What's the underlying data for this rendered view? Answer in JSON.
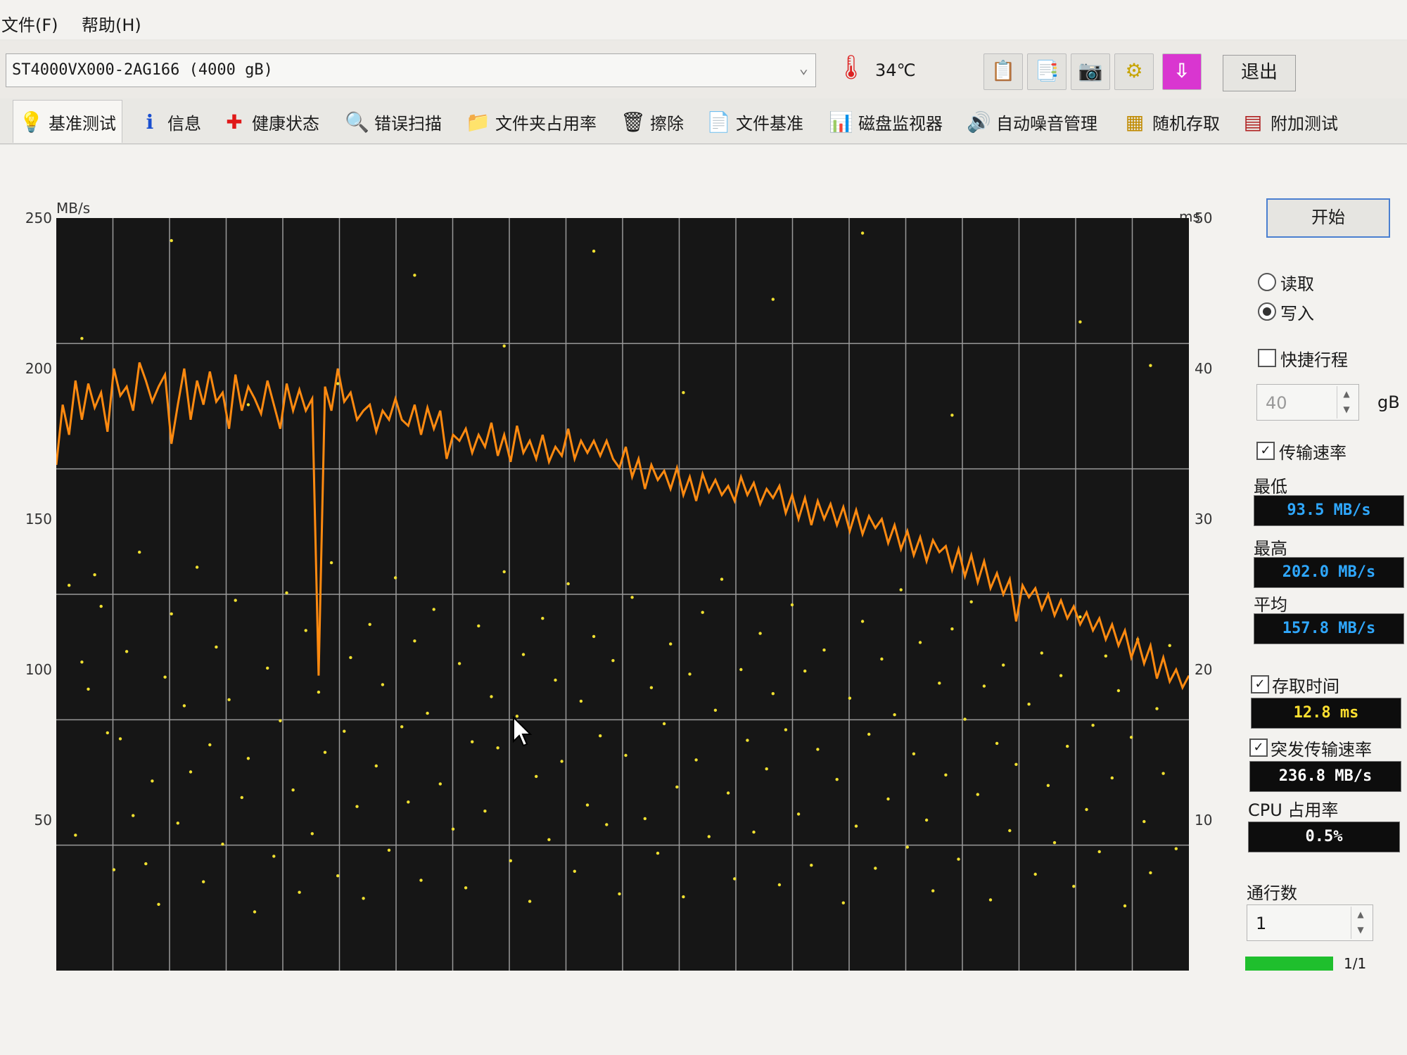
{
  "menu": {
    "file": "文件(F)",
    "help": "帮助(H)"
  },
  "toolbar": {
    "drive": "ST4000VX000-2AG166 (4000 gB)",
    "temperature": "34℃",
    "exit_label": "退出",
    "icons": [
      "copy-text-icon",
      "copy-graph-icon",
      "camera-icon",
      "settings-icon",
      "download-icon"
    ]
  },
  "tabs": [
    {
      "label": "基准测试",
      "icon": "benchmark-icon"
    },
    {
      "label": "信息",
      "icon": "info-icon"
    },
    {
      "label": "健康状态",
      "icon": "health-icon"
    },
    {
      "label": "错误扫描",
      "icon": "error-scan-icon"
    },
    {
      "label": "文件夹占用率",
      "icon": "folder-icon"
    },
    {
      "label": "擦除",
      "icon": "erase-icon"
    },
    {
      "label": "文件基准",
      "icon": "file-benchmark-icon"
    },
    {
      "label": "磁盘监视器",
      "icon": "disk-monitor-icon"
    },
    {
      "label": "自动噪音管理",
      "icon": "noise-icon"
    },
    {
      "label": "随机存取",
      "icon": "random-access-icon"
    },
    {
      "label": "附加测试",
      "icon": "extra-tests-icon"
    }
  ],
  "panel": {
    "start_label": "开始",
    "read_label": "读取",
    "write_label": "写入",
    "write_selected": true,
    "quick_label": "快捷行程",
    "quick_checked": false,
    "quick_value": "40",
    "quick_unit": "gB",
    "transfer_label": "传输速率",
    "transfer_checked": true,
    "min_label": "最低",
    "min_value": "93.5 MB/s",
    "max_label": "最高",
    "max_value": "202.0 MB/s",
    "avg_label": "平均",
    "avg_value": "157.8 MB/s",
    "access_label": "存取时间",
    "access_checked": true,
    "access_value": "12.8 ms",
    "burst_label": "突发传输速率",
    "burst_checked": true,
    "burst_value": "236.8 MB/s",
    "cpu_label": "CPU 占用率",
    "cpu_value": "0.5%",
    "passes_label": "通行数",
    "passes_value": "1",
    "progress_text": "1/1",
    "progress": 1.0,
    "readout_blue": "#2fa8ff",
    "readout_yellow": "#ffe030"
  },
  "chart_data": {
    "type": "line",
    "ylabel_left": "MB/s",
    "ylabel_right": "ms",
    "ylim": [
      0,
      250
    ],
    "ylim_right": [
      0,
      50
    ],
    "yticks_left": [
      50,
      100,
      150,
      200,
      250
    ],
    "yticks_right": [
      10,
      20,
      30,
      40,
      50
    ],
    "grid": true,
    "line_color": "#ff8a10",
    "dot_color": "#f0e030",
    "background": "#161616",
    "series": [
      {
        "values": [
          168,
          188,
          178,
          196,
          183,
          195,
          187,
          192,
          179,
          200,
          191,
          194,
          186,
          202,
          196,
          189,
          194,
          198,
          175,
          188,
          200,
          183,
          196,
          188,
          199,
          189,
          192,
          180,
          198,
          186,
          194,
          190,
          185,
          196,
          188,
          180,
          195,
          186,
          193,
          186,
          190,
          98,
          194,
          186,
          200,
          189,
          192,
          183,
          186,
          188,
          179,
          186,
          183,
          190,
          183,
          181,
          188,
          178,
          187,
          180,
          186,
          170,
          178,
          176,
          180,
          172,
          178,
          174,
          182,
          171,
          178,
          169,
          181,
          172,
          176,
          170,
          178,
          169,
          174,
          171,
          180,
          170,
          176,
          172,
          176,
          171,
          176,
          170,
          167,
          174,
          164,
          170,
          160,
          168,
          163,
          166,
          160,
          167,
          158,
          164,
          156,
          165,
          159,
          163,
          158,
          161,
          156,
          164,
          158,
          162,
          155,
          160,
          157,
          161,
          152,
          158,
          150,
          157,
          148,
          156,
          150,
          155,
          148,
          154,
          146,
          153,
          145,
          151,
          147,
          150,
          142,
          148,
          140,
          146,
          138,
          144,
          136,
          143,
          139,
          141,
          133,
          140,
          131,
          138,
          129,
          136,
          127,
          132,
          125,
          130,
          116,
          128,
          124,
          127,
          120,
          125,
          118,
          123,
          117,
          121,
          115,
          119,
          113,
          117,
          110,
          115,
          108,
          113,
          104,
          110,
          102,
          108,
          97,
          104,
          96,
          100,
          94,
          98
        ]
      }
    ],
    "access_points_ms": [
      [
        2,
        25.6
      ],
      [
        3,
        9.0
      ],
      [
        4,
        20.5
      ],
      [
        5,
        18.7
      ],
      [
        6,
        26.3
      ],
      [
        7,
        24.2
      ],
      [
        8,
        15.8
      ],
      [
        9,
        6.7
      ],
      [
        10,
        15.4
      ],
      [
        11,
        21.2
      ],
      [
        12,
        10.3
      ],
      [
        13,
        27.8
      ],
      [
        14,
        7.1
      ],
      [
        15,
        12.6
      ],
      [
        16,
        4.4
      ],
      [
        17,
        19.5
      ],
      [
        18,
        23.7
      ],
      [
        19,
        9.8
      ],
      [
        20,
        17.6
      ],
      [
        21,
        13.2
      ],
      [
        22,
        26.8
      ],
      [
        23,
        5.9
      ],
      [
        24,
        15.0
      ],
      [
        25,
        21.5
      ],
      [
        26,
        8.4
      ],
      [
        27,
        18.0
      ],
      [
        28,
        24.6
      ],
      [
        29,
        11.5
      ],
      [
        30,
        14.1
      ],
      [
        31,
        3.9
      ],
      [
        33,
        20.1
      ],
      [
        34,
        7.6
      ],
      [
        35,
        16.6
      ],
      [
        36,
        25.1
      ],
      [
        37,
        12.0
      ],
      [
        38,
        5.2
      ],
      [
        39,
        22.6
      ],
      [
        40,
        9.1
      ],
      [
        41,
        18.5
      ],
      [
        42,
        14.5
      ],
      [
        43,
        27.1
      ],
      [
        44,
        6.3
      ],
      [
        45,
        15.9
      ],
      [
        46,
        20.8
      ],
      [
        47,
        10.9
      ],
      [
        48,
        4.8
      ],
      [
        49,
        23.0
      ],
      [
        50,
        13.6
      ],
      [
        51,
        19.0
      ],
      [
        52,
        8.0
      ],
      [
        53,
        26.1
      ],
      [
        54,
        16.2
      ],
      [
        55,
        11.2
      ],
      [
        56,
        21.9
      ],
      [
        57,
        6.0
      ],
      [
        58,
        17.1
      ],
      [
        59,
        24.0
      ],
      [
        60,
        12.4
      ],
      [
        62,
        9.4
      ],
      [
        63,
        20.4
      ],
      [
        64,
        5.5
      ],
      [
        65,
        15.2
      ],
      [
        66,
        22.9
      ],
      [
        67,
        10.6
      ],
      [
        68,
        18.2
      ],
      [
        69,
        14.8
      ],
      [
        70,
        26.5
      ],
      [
        71,
        7.3
      ],
      [
        72,
        16.9
      ],
      [
        73,
        21.0
      ],
      [
        74,
        4.6
      ],
      [
        75,
        12.9
      ],
      [
        76,
        23.4
      ],
      [
        77,
        8.7
      ],
      [
        78,
        19.3
      ],
      [
        79,
        13.9
      ],
      [
        80,
        25.7
      ],
      [
        81,
        6.6
      ],
      [
        82,
        17.9
      ],
      [
        83,
        11.0
      ],
      [
        84,
        22.2
      ],
      [
        85,
        15.6
      ],
      [
        86,
        9.7
      ],
      [
        87,
        20.6
      ],
      [
        88,
        5.1
      ],
      [
        89,
        14.3
      ],
      [
        90,
        24.8
      ],
      [
        92,
        10.1
      ],
      [
        93,
        18.8
      ],
      [
        94,
        7.8
      ],
      [
        95,
        16.4
      ],
      [
        96,
        21.7
      ],
      [
        97,
        12.2
      ],
      [
        98,
        4.9
      ],
      [
        99,
        19.7
      ],
      [
        100,
        14.0
      ],
      [
        101,
        23.8
      ],
      [
        102,
        8.9
      ],
      [
        103,
        17.3
      ],
      [
        104,
        26.0
      ],
      [
        105,
        11.8
      ],
      [
        106,
        6.1
      ],
      [
        107,
        20.0
      ],
      [
        108,
        15.3
      ],
      [
        109,
        9.2
      ],
      [
        110,
        22.4
      ],
      [
        111,
        13.4
      ],
      [
        112,
        18.4
      ],
      [
        113,
        5.7
      ],
      [
        114,
        16.0
      ],
      [
        115,
        24.3
      ],
      [
        116,
        10.4
      ],
      [
        117,
        19.9
      ],
      [
        118,
        7.0
      ],
      [
        119,
        14.7
      ],
      [
        120,
        21.3
      ],
      [
        122,
        12.7
      ],
      [
        123,
        4.5
      ],
      [
        124,
        18.1
      ],
      [
        125,
        9.6
      ],
      [
        126,
        23.2
      ],
      [
        127,
        15.7
      ],
      [
        128,
        6.8
      ],
      [
        129,
        20.7
      ],
      [
        130,
        11.4
      ],
      [
        131,
        17.0
      ],
      [
        132,
        25.3
      ],
      [
        133,
        8.2
      ],
      [
        134,
        14.4
      ],
      [
        135,
        21.8
      ],
      [
        136,
        10.0
      ],
      [
        137,
        5.3
      ],
      [
        138,
        19.1
      ],
      [
        139,
        13.0
      ],
      [
        140,
        22.7
      ],
      [
        141,
        7.4
      ],
      [
        142,
        16.7
      ],
      [
        143,
        24.5
      ],
      [
        144,
        11.7
      ],
      [
        145,
        18.9
      ],
      [
        146,
        4.7
      ],
      [
        147,
        15.1
      ],
      [
        148,
        20.3
      ],
      [
        149,
        9.3
      ],
      [
        150,
        13.7
      ],
      [
        152,
        17.7
      ],
      [
        153,
        6.4
      ],
      [
        154,
        21.1
      ],
      [
        155,
        12.3
      ],
      [
        156,
        8.5
      ],
      [
        157,
        19.6
      ],
      [
        158,
        14.9
      ],
      [
        159,
        5.6
      ],
      [
        160,
        23.5
      ],
      [
        161,
        10.7
      ],
      [
        162,
        16.3
      ],
      [
        163,
        7.9
      ],
      [
        164,
        20.9
      ],
      [
        165,
        12.8
      ],
      [
        166,
        18.6
      ],
      [
        167,
        4.3
      ],
      [
        168,
        15.5
      ],
      [
        169,
        22.0
      ],
      [
        170,
        9.9
      ],
      [
        171,
        6.5
      ],
      [
        172,
        17.4
      ],
      [
        173,
        13.1
      ],
      [
        174,
        21.6
      ],
      [
        175,
        8.1
      ],
      [
        4,
        42.0
      ],
      [
        18,
        48.5
      ],
      [
        30,
        37.6
      ],
      [
        44,
        39.0
      ],
      [
        56,
        46.2
      ],
      [
        70,
        41.5
      ],
      [
        84,
        47.8
      ],
      [
        98,
        38.4
      ],
      [
        112,
        44.6
      ],
      [
        126,
        49.0
      ],
      [
        140,
        36.9
      ],
      [
        160,
        43.1
      ],
      [
        171,
        40.2
      ]
    ]
  }
}
